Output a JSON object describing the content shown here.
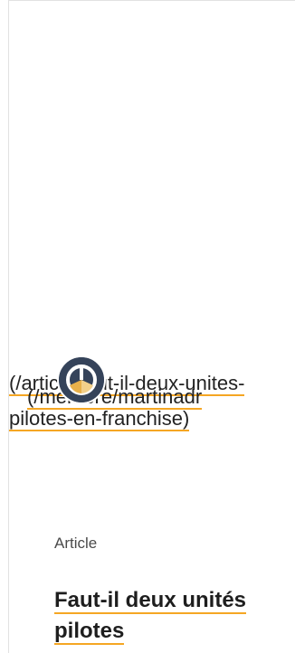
{
  "card": {
    "article_href_text": "(/article/faut-il-deux-unites-pilotes-en-franchise)",
    "member_href_text": "(/membre/martinadr",
    "kind": "Article",
    "title": "Faut-il deux unités pilotes"
  },
  "colors": {
    "link_underline": "#f5a623",
    "avatar_bg": "#35435a",
    "avatar_accent": "#e8b04a"
  },
  "icons": {
    "avatar": "user-avatar-icon"
  }
}
